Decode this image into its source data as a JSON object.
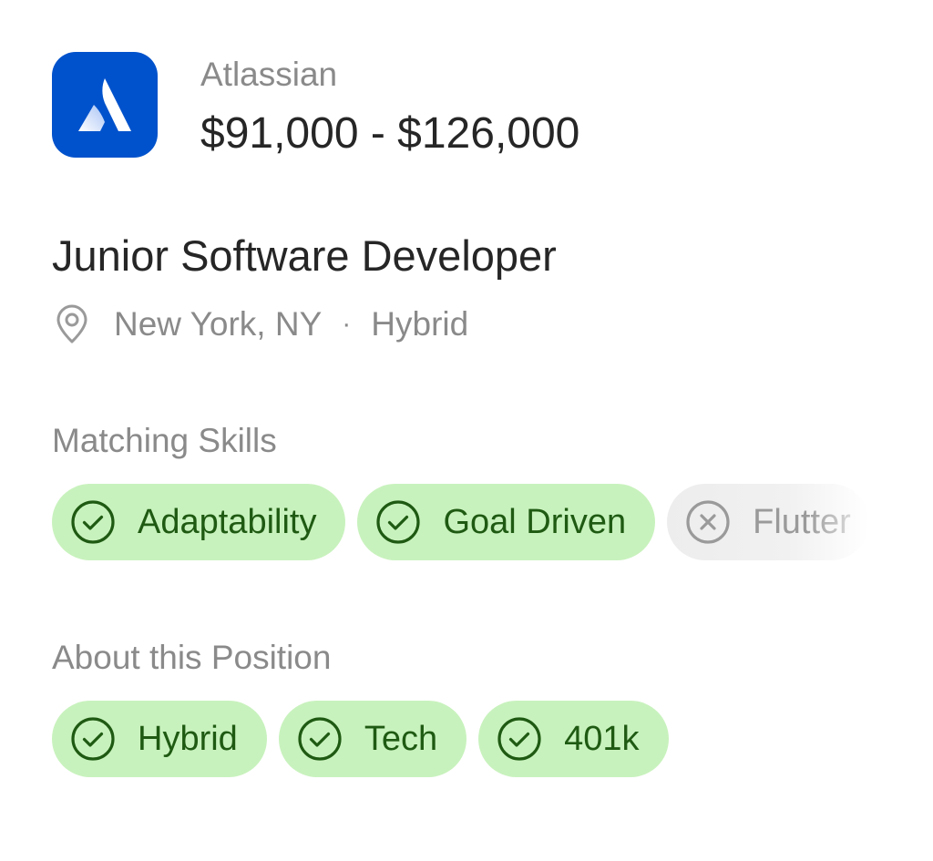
{
  "job": {
    "company": "Atlassian",
    "salary": "$91,000 - $126,000",
    "title": "Junior Software Developer",
    "location": "New York, NY",
    "separator": "·",
    "work_mode": "Hybrid"
  },
  "matching_skills": {
    "label": "Matching Skills",
    "items": [
      {
        "label": "Adaptability",
        "matched": true,
        "icon": "check-circle-icon"
      },
      {
        "label": "Goal Driven",
        "matched": true,
        "icon": "check-circle-icon"
      },
      {
        "label": "Flutter",
        "matched": false,
        "icon": "x-circle-icon"
      }
    ]
  },
  "about_position": {
    "label": "About this Position",
    "items": [
      {
        "label": "Hybrid",
        "icon": "check-circle-icon"
      },
      {
        "label": "Tech",
        "icon": "check-circle-icon"
      },
      {
        "label": "401k",
        "icon": "check-circle-icon"
      }
    ]
  },
  "colors": {
    "brand_blue": "#0052cc",
    "chip_matched_bg": "#c8f2bd",
    "chip_matched_text": "#1f5a13",
    "chip_missing_bg": "#ededed",
    "muted_text": "#8a8a8a"
  }
}
